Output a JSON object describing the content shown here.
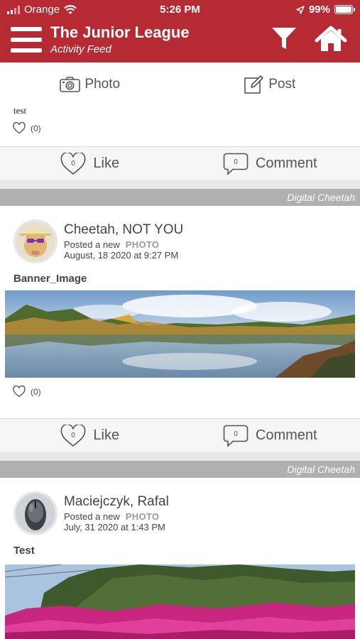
{
  "status_bar": {
    "carrier": "Orange",
    "time": "5:26 PM",
    "battery": "99%",
    "battery_level": 0.99
  },
  "header": {
    "title": "The Junior League",
    "subtitle": "Activity Feed",
    "bg_color": "#b52a33"
  },
  "compose": {
    "photo_label": "Photo",
    "post_label": "Post"
  },
  "post0": {
    "text": "test",
    "like_count": "(0)",
    "like_label": "Like",
    "comment_label": "Comment",
    "like_badge": "0",
    "comment_badge": "0"
  },
  "post1": {
    "group": "Digital Cheetah",
    "author": "Cheetah, NOT YOU",
    "posted_prefix": "Posted a new",
    "posted_type": "PHOTO",
    "date": "August, 18 2020 at 9:27 PM",
    "title": "Banner_Image",
    "like_count": "(0)",
    "like_label": "Like",
    "comment_label": "Comment",
    "like_badge": "0",
    "comment_badge": "0"
  },
  "post2": {
    "group": "Digital Cheetah",
    "author": "Maciejczyk, Rafal",
    "posted_prefix": "Posted a new",
    "posted_type": "PHOTO",
    "date": "July, 31 2020 at 1:43 PM",
    "title": "Test"
  },
  "icons": [
    "signal-icon",
    "wifi-icon",
    "location-arrow-icon",
    "battery-icon",
    "hamburger-menu-icon",
    "filter-icon",
    "home-icon",
    "camera-icon",
    "edit-icon",
    "heart-icon",
    "comment-icon"
  ]
}
